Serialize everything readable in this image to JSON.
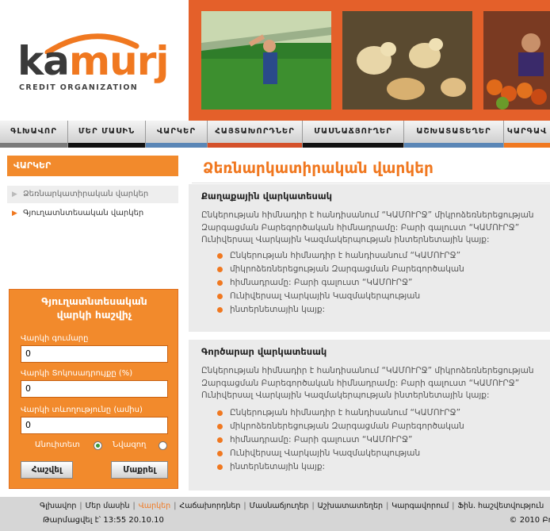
{
  "brand": {
    "logo_part1": "ka",
    "logo_part2": "murj",
    "tagline": "CREDIT ORGANIZATION",
    "colors": {
      "orange": "#f07820",
      "dark": "#3a3a3a"
    }
  },
  "nav": {
    "items": [
      {
        "label": "ԳԼԽԱՎՈՐ",
        "bar": "#7a7a7a"
      },
      {
        "label": "ՄԵՐ ՄԱՍԻՆ",
        "bar": "#111111"
      },
      {
        "label": "ՎԱՐԿԵՐ",
        "bar": "#5a86b6"
      },
      {
        "label": "ՀԱՅՏԱԽՈՐԴՆԵՐ",
        "bar": "#d4502a"
      },
      {
        "label": "ՄԱՍՆԱՃՅՈՒՂԵՐ",
        "bar": "#111111"
      },
      {
        "label": "ԱՇԽԱՏԱՏԵՂԵՐ",
        "bar": "#5a86b6"
      },
      {
        "label": "ԿԱՐԳԱՎ",
        "bar": "#f07820"
      }
    ]
  },
  "sidebar": {
    "menu_title": "ՎԱՐԿԵՐ",
    "items": [
      {
        "label": "Ձեռնարկատիրական վարկեր"
      },
      {
        "label": "Գյուղատնտեսական վարկեր"
      }
    ]
  },
  "calculator": {
    "title_line1": "Գյուղատնտեսական",
    "title_line2": "վարկի հաշվիչ",
    "amount_label": "Վարկի գումարը",
    "amount_value": "0",
    "rate_label": "Վարկի Տոկոսադրույքը (%)",
    "rate_value": "0",
    "term_label": "Վարկի տևողությունը (ամիս)",
    "term_value": "0",
    "option_annuity": "Անուիտետ",
    "option_fixed": "Նվազող",
    "selected_option": "Անուիտետ",
    "calc_button": "Հաշվել",
    "clear_button": "Մաքրել"
  },
  "main": {
    "title": "Ձեռնարկատիրական վարկեր",
    "sections": [
      {
        "heading": "Քաղաքային վարկատեսակ",
        "paragraph_lines": [
          "Ընկերության հիմնադիր է հանդիսանում “ԿԱՄՈՒՐՋ” միկրոձեռներեցության",
          "Զարգացման Բարեգործական հիմնադրամը: Բարի գալուստ “ԿԱՄՈՒՐՋ”",
          "Ունիվերսալ Վարկային Կազմակերպության ինտերնետային  կայք:"
        ],
        "bullets": [
          "Ընկերության հիմնադիր է հանդիսանում “ԿԱՄՈՒՐՋ”",
          "միկրոձեռներեցության Զարգացման Բարեգործական",
          "հիմնադրամը: Բարի գալուստ “ԿԱՄՈՒՐՋ”",
          "Ունիվերսալ Վարկային Կազմակերպության",
          "ինտերնետային  կայք:"
        ]
      },
      {
        "heading": "Գործարար վարկատեսակ",
        "paragraph_lines": [
          "Ընկերության հիմնադիր է հանդիսանում “ԿԱՄՈՒՐՋ” միկրոձեռներեցության",
          "Զարգացման Բարեգործական հիմնադրամը: Բարի գալուստ “ԿԱՄՈՒՐՋ”",
          "Ունիվերսալ Վարկային Կազմակերպության ինտերնետային  կայք:"
        ],
        "bullets": [
          "Ընկերության հիմնադիր է հանդիսանում “ԿԱՄՈՒՐՋ”",
          "միկրոձեռներեցության Զարգացման Բարեգործական",
          "հիմնադրամը: Բարի գալուստ “ԿԱՄՈՒՐՋ”",
          "Ունիվերսալ Վարկային Կազմակերպության",
          "ինտերնետային  կայք:"
        ]
      }
    ]
  },
  "footer": {
    "links": [
      {
        "label": "Գլխավոր",
        "active": false
      },
      {
        "label": "Մեր մասին",
        "active": false
      },
      {
        "label": "Վարկեր",
        "active": true
      },
      {
        "label": "Հաճախորդներ",
        "active": false
      },
      {
        "label": "Մասնաճյուղեր",
        "active": false
      },
      {
        "label": "Աշխատատեղեր",
        "active": false
      },
      {
        "label": "Կարգավորում",
        "active": false
      },
      {
        "label": "Ֆին. հաշվետվություն",
        "active": false
      }
    ],
    "updated": "Թարմացվել է՝ 13:55  20.10.10",
    "copyright": "© 2010 Բո"
  }
}
